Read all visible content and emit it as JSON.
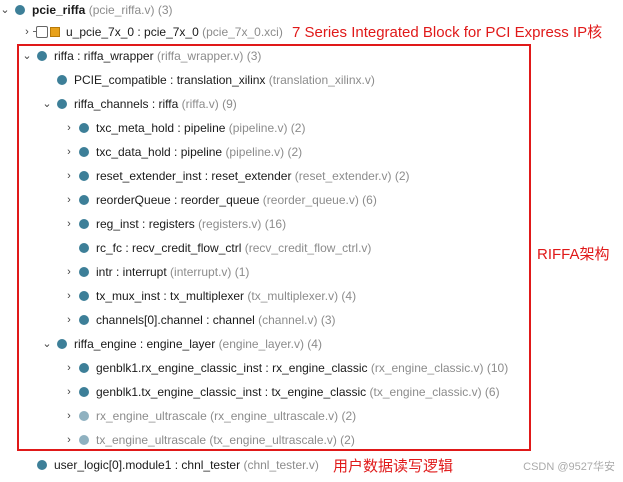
{
  "tree": {
    "root": {
      "name": "pcie_riffa",
      "file": "(pcie_riffa.v) (3)"
    },
    "ip_core": {
      "name": "u_pcie_7x_0 : pcie_7x_0",
      "file": "(pcie_7x_0.xci)"
    },
    "riffa": {
      "name": "riffa : riffa_wrapper",
      "file": "(riffa_wrapper.v) (3)"
    },
    "pcie_compatible": {
      "name": "PCIE_compatible : translation_xilinx",
      "file": "(translation_xilinx.v)"
    },
    "riffa_channels": {
      "name": "riffa_channels : riffa",
      "file": "(riffa.v) (9)"
    },
    "channels_children": [
      {
        "name": "txc_meta_hold : pipeline",
        "file": "(pipeline.v) (2)"
      },
      {
        "name": "txc_data_hold : pipeline",
        "file": "(pipeline.v) (2)"
      },
      {
        "name": "reset_extender_inst : reset_extender",
        "file": "(reset_extender.v) (2)"
      },
      {
        "name": "reorderQueue : reorder_queue",
        "file": "(reorder_queue.v) (6)"
      },
      {
        "name": "reg_inst : registers",
        "file": "(registers.v) (16)"
      },
      {
        "name": "rc_fc : recv_credit_flow_ctrl",
        "file": "(recv_credit_flow_ctrl.v)"
      },
      {
        "name": "intr : interrupt",
        "file": "(interrupt.v) (1)"
      },
      {
        "name": "tx_mux_inst : tx_multiplexer",
        "file": "(tx_multiplexer.v) (4)"
      },
      {
        "name": "channels[0].channel : channel",
        "file": "(channel.v) (3)"
      }
    ],
    "riffa_engine": {
      "name": "riffa_engine : engine_layer",
      "file": "(engine_layer.v) (4)"
    },
    "engine_children": [
      {
        "name": "genblk1.rx_engine_classic_inst : rx_engine_classic",
        "file": "(rx_engine_classic.v) (10)"
      },
      {
        "name": "genblk1.tx_engine_classic_inst : tx_engine_classic",
        "file": "(tx_engine_classic.v) (6)"
      },
      {
        "name": "rx_engine_ultrascale",
        "file": "(rx_engine_ultrascale.v) (2)"
      },
      {
        "name": "tx_engine_ultrascale",
        "file": "(tx_engine_ultrascale.v) (2)"
      }
    ],
    "user_logic": {
      "name": "user_logic[0].module1 : chnl_tester",
      "file": "(chnl_tester.v)"
    }
  },
  "annotations": {
    "ip_label": "7 Series Integrated Block for PCI Express IP核",
    "riffa_label": "RIFFA架构",
    "user_label": "用户数据读写逻辑"
  },
  "watermark": "CSDN @9527华安",
  "colors": {
    "node_dot": "#3d7f98",
    "annotation": "#e01919"
  },
  "icons": {
    "expanded": "chevron-down-icon",
    "collapsed": "chevron-right-icon",
    "ip": "ip-core-icon"
  }
}
